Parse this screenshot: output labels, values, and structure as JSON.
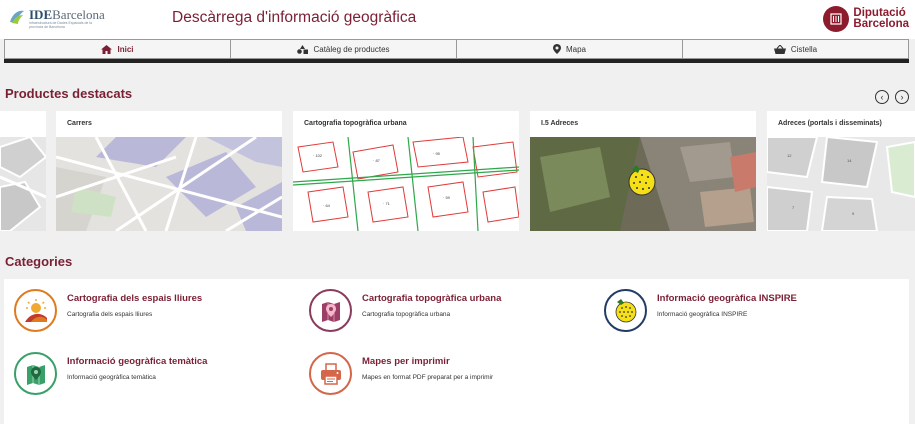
{
  "header": {
    "logo_name": "IDE",
    "logo_suffix": "Barcelona",
    "logo_sub": "Infraestructura de Dades Espacials de la província de Barcelona",
    "title": "Descàrrega d'informació geogràfica",
    "org_line1": "Diputació",
    "org_line2": "Barcelona"
  },
  "nav": {
    "items": [
      {
        "label": "Inici",
        "icon": "home-icon"
      },
      {
        "label": "Catàleg de productes",
        "icon": "shapes-icon"
      },
      {
        "label": "Mapa",
        "icon": "map-marker-icon"
      },
      {
        "label": "Cistella",
        "icon": "basket-icon"
      }
    ]
  },
  "featured": {
    "title": "Productes destacats",
    "prev_icon": "chevron-left-icon",
    "next_icon": "chevron-right-icon",
    "products": [
      {
        "title": ""
      },
      {
        "title": "Carrers"
      },
      {
        "title": "Cartografia topogràfica urbana"
      },
      {
        "title": "I.5 Adreces"
      },
      {
        "title": "Adreces (portals i disseminats)"
      }
    ]
  },
  "categories": {
    "title": "Categories",
    "items": [
      {
        "name": "Cartografia dels espais lliures",
        "desc": "Cartografia dels espais lliures",
        "icon": "landscape-icon",
        "color": "#e07a1f"
      },
      {
        "name": "Cartografia topogràfica urbana",
        "desc": "Cartografia topogràfica urbana",
        "icon": "map-pin-icon",
        "color": "#8a3a5c"
      },
      {
        "name": "Informació geogràfica INSPIRE",
        "desc": "Informació geogràfica INSPIRE",
        "icon": "inspire-icon",
        "color": "#223c66"
      },
      {
        "name": "Informació geogràfica temàtica",
        "desc": "Informació geogràfica temàtica",
        "icon": "thematic-map-icon",
        "color": "#3aa06a"
      },
      {
        "name": "Mapes per imprimir",
        "desc": "Mapes en format PDF preparat per a imprimir",
        "icon": "printer-icon",
        "color": "#d4664a"
      }
    ]
  },
  "colors": {
    "accent": "#7a1f34",
    "brand": "#8c1b2e"
  }
}
